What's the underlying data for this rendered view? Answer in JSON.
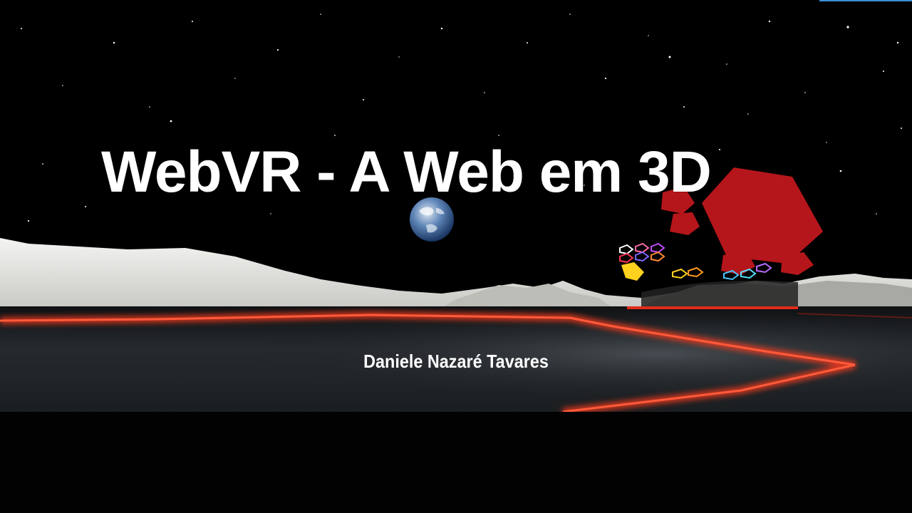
{
  "slide": {
    "title": "WebVR - A Web em 3D",
    "subtitle": "Daniele Nazaré Tavares"
  },
  "icons": [
    "earth-icon",
    "red-hexagon-icon"
  ],
  "colors": {
    "background": "#000000",
    "title_text": "#ffffff",
    "accent_red": "#b5161b",
    "floor": "#1e2226",
    "glow_red": "#ff3b1f",
    "terrain": "#e9e9e6"
  }
}
